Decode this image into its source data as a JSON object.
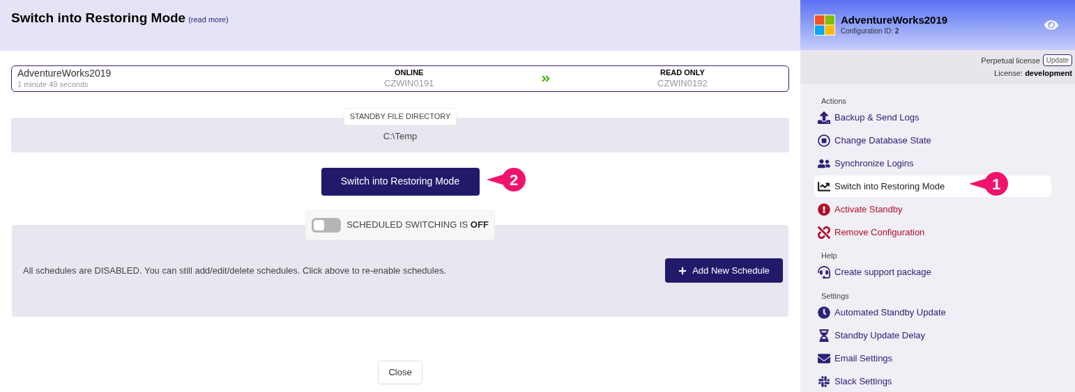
{
  "page": {
    "title": "Switch into Restoring Mode",
    "read_more": "(read more)"
  },
  "status": {
    "database": "AdventureWorks2019",
    "elapsed": "1 minute 49 seconds",
    "primary_state": "ONLINE",
    "primary_server": "CZWIN0191",
    "secondary_state": "READ ONLY",
    "secondary_server": "CZWIN0192"
  },
  "standby_directory": {
    "label": "STANDBY FILE DIRECTORY",
    "value": "C:\\Temp"
  },
  "primary_button": "Switch into Restoring Mode",
  "scheduled_switching": {
    "label": "SCHEDULED SWITCHING IS",
    "state_text": "OFF",
    "on": false
  },
  "schedules": {
    "message": "All schedules are DISABLED. You can still add/edit/delete schedules. Click above to re-enable schedules.",
    "add_button": "Add New Schedule"
  },
  "close_button": "Close",
  "sidebar": {
    "title": "AdventureWorks2019",
    "config_label": "Configuration ID:",
    "config_id": "2",
    "license_type": "Perpetual license",
    "update_button": "Update",
    "license_label": "License:",
    "license_value": "development",
    "sections": [
      {
        "heading": "Actions",
        "items": [
          {
            "label": "Backup & Send Logs",
            "kind": "normal",
            "selected": false
          },
          {
            "label": "Change Database State",
            "kind": "normal",
            "selected": false
          },
          {
            "label": "Synchronize Logins",
            "kind": "normal",
            "selected": false
          },
          {
            "label": "Switch into Restoring Mode",
            "kind": "normal",
            "selected": true
          },
          {
            "label": "Activate Standby",
            "kind": "danger",
            "selected": false
          },
          {
            "label": "Remove Configuration",
            "kind": "danger",
            "selected": false
          }
        ]
      },
      {
        "heading": "Help",
        "items": [
          {
            "label": "Create support package",
            "kind": "normal",
            "selected": false
          }
        ]
      },
      {
        "heading": "Settings",
        "items": [
          {
            "label": "Automated Standby Update",
            "kind": "normal",
            "selected": false
          },
          {
            "label": "Standby Update Delay",
            "kind": "normal",
            "selected": false
          },
          {
            "label": "Email Settings",
            "kind": "normal",
            "selected": false
          },
          {
            "label": "Slack Settings",
            "kind": "normal",
            "selected": false
          }
        ]
      }
    ]
  },
  "callouts": [
    "1",
    "2"
  ]
}
